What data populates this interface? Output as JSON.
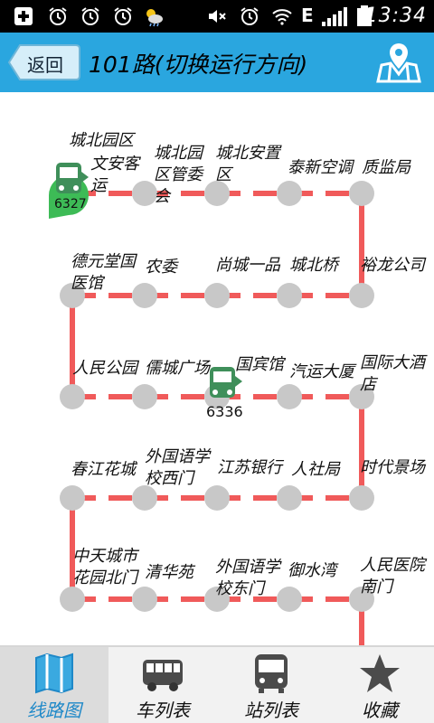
{
  "status": {
    "time": "13:34",
    "network": "E"
  },
  "header": {
    "back_label": "返回",
    "title": "101路(切换运行方向)"
  },
  "colors": {
    "accent": "#2aa6df",
    "line": "#f05a5a",
    "stop": "#c8c8c8",
    "bus": "#3f8f5a"
  },
  "stops": [
    {
      "name": "城北园区"
    },
    {
      "name": "城北园区管委会"
    },
    {
      "name": "城北安置区"
    },
    {
      "name": "泰新空调"
    },
    {
      "name": "质监局"
    },
    {
      "name": "裕龙公司"
    },
    {
      "name": "城北桥"
    },
    {
      "name": "尚城一品"
    },
    {
      "name": "农委"
    },
    {
      "name": "德元堂国医馆"
    },
    {
      "name": "人民公园"
    },
    {
      "name": "儒城广场"
    },
    {
      "name": "国宾馆"
    },
    {
      "name": "汽运大厦"
    },
    {
      "name": "国际大酒店"
    },
    {
      "name": "时代景场"
    },
    {
      "name": "人社局"
    },
    {
      "name": "江苏银行"
    },
    {
      "name": "外国语学校西门"
    },
    {
      "name": "春江花城"
    },
    {
      "name": "中天城市花园北门"
    },
    {
      "name": "清华苑"
    },
    {
      "name": "外国语学校东门"
    },
    {
      "name": "御水湾"
    },
    {
      "name": "人民医院南门"
    }
  ],
  "buses": [
    {
      "label": "文安客运",
      "plate": "6327"
    },
    {
      "plate": "6336"
    }
  ],
  "tabs": [
    {
      "label": "线路图",
      "icon": "map-icon"
    },
    {
      "label": "车列表",
      "icon": "bus-icon"
    },
    {
      "label": "站列表",
      "icon": "bus-stop-icon"
    },
    {
      "label": "收藏",
      "icon": "star-icon"
    }
  ]
}
